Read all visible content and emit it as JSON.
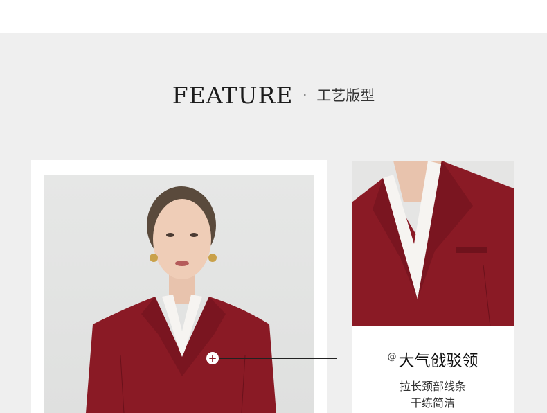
{
  "heading": {
    "en": "FEATURE",
    "separator": "·",
    "zh": "工艺版型"
  },
  "feature": {
    "marker": "@",
    "title": "大气戗驳领",
    "line1": "拉长颈部线条",
    "line2": "干练简洁",
    "hotspot_icon": "+"
  },
  "colors": {
    "background_band": "#efefef",
    "blazer_red": "#8a1a25",
    "text_dark": "#111111"
  },
  "icons": [
    "plus-icon"
  ]
}
